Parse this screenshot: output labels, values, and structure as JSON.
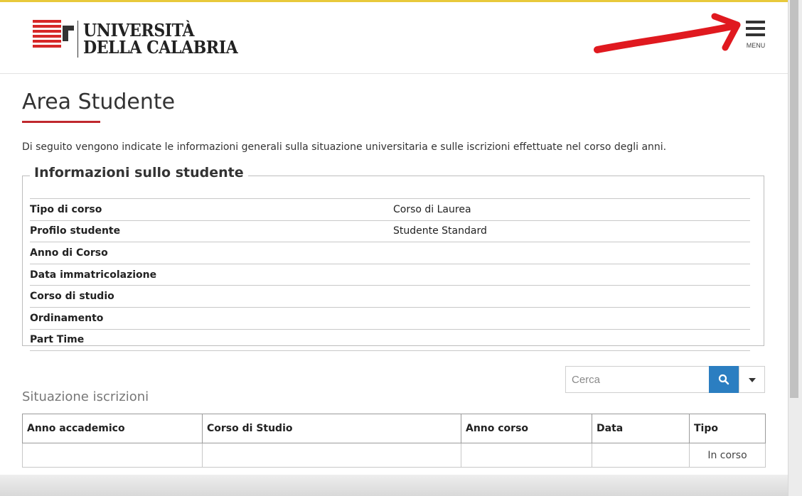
{
  "header": {
    "logo_line1": "UNIVERSITÀ",
    "logo_line2": "DELLA CALABRIA",
    "menu_label": "MENU"
  },
  "page": {
    "title": "Area Studente",
    "intro": "Di seguito vengono indicate le informazioni generali sulla situazione universitaria e sulle iscrizioni effettuate nel corso degli anni."
  },
  "info": {
    "legend": "Informazioni sullo studente",
    "rows": [
      {
        "label": "Tipo di corso",
        "value": "Corso di Laurea"
      },
      {
        "label": "Profilo studente",
        "value": "Studente Standard"
      },
      {
        "label": "Anno di Corso",
        "value": ""
      },
      {
        "label": "Data immatricolazione",
        "value": ""
      },
      {
        "label": "Corso di studio",
        "value": ""
      },
      {
        "label": "Ordinamento",
        "value": ""
      },
      {
        "label": "Part Time",
        "value": ""
      }
    ]
  },
  "search": {
    "placeholder": "Cerca"
  },
  "registrations": {
    "title": "Situazione iscrizioni",
    "columns": [
      "Anno accademico",
      "Corso di Studio",
      "Anno corso",
      "Data",
      "Tipo"
    ],
    "rows": [
      {
        "anno_accademico": "",
        "corso": "",
        "anno_corso": "",
        "data": "",
        "tipo": "In corso"
      }
    ]
  },
  "colors": {
    "accent_red": "#c0282d",
    "search_blue": "#2b7ec1",
    "annotation_red": "#e0191f",
    "top_line": "#e8c93b"
  },
  "icons": {
    "logo": "uni-logo-icon",
    "menu": "hamburger-menu-icon",
    "search": "search-icon",
    "dropdown": "caret-down-icon"
  }
}
